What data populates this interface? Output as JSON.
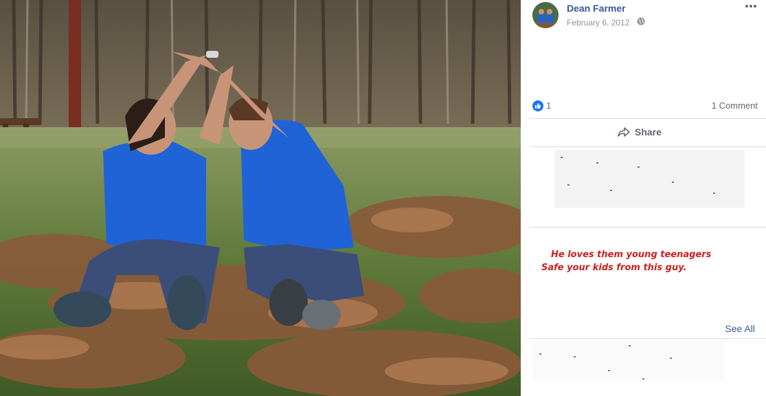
{
  "post": {
    "author": "Dean Farmer",
    "date": "February 6, 2012",
    "privacy_icon": "globe-icon",
    "more_icon": "more-horizontal-icon"
  },
  "reactions": {
    "icon": "like-icon",
    "like_count": "1",
    "comment_count": "1 Comment"
  },
  "actions": {
    "share_label": "Share",
    "share_icon": "share-arrow-icon"
  },
  "overlay": {
    "line1": "He loves them young teenagers",
    "line2": "Safe your kids from this guy.",
    "color": "#cc1f1f"
  },
  "comments": {
    "see_all": "See All"
  },
  "colors": {
    "link": "#385898",
    "meta": "#90949c",
    "like": "#1877f2",
    "shirt": "#1f63d6"
  }
}
